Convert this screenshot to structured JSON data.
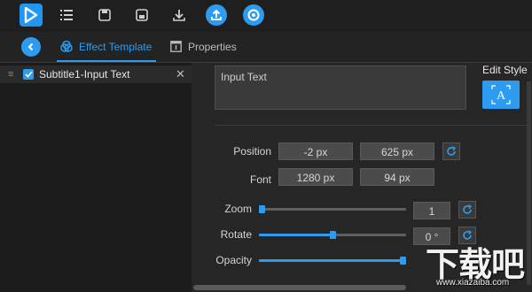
{
  "tabs": [
    {
      "label": "Effect Template",
      "icon": "effect-template-icon"
    },
    {
      "label": "Properties",
      "icon": "properties-icon"
    }
  ],
  "layers": [
    {
      "label": "Subtitle1-Input Text",
      "checked": true
    }
  ],
  "text_input": {
    "value": "Input Text"
  },
  "edit_style": {
    "label": "Edit Style",
    "icon_letter": "A"
  },
  "position": {
    "label": "Position",
    "x": "-2 px",
    "y": "625 px"
  },
  "font": {
    "label": "Font",
    "width": "1280 px",
    "height": "94 px"
  },
  "zoom": {
    "label": "Zoom",
    "value": "1",
    "level": 0.0
  },
  "rotate": {
    "label": "Rotate",
    "value": "0 °",
    "level": 0.5
  },
  "opacity": {
    "label": "Opacity",
    "level": 1.0
  },
  "watermark": {
    "big": "下载吧",
    "small": "www.xiazaiba.com"
  },
  "colors": {
    "accent": "#2d9cf0",
    "background": "#2a2a2a"
  }
}
